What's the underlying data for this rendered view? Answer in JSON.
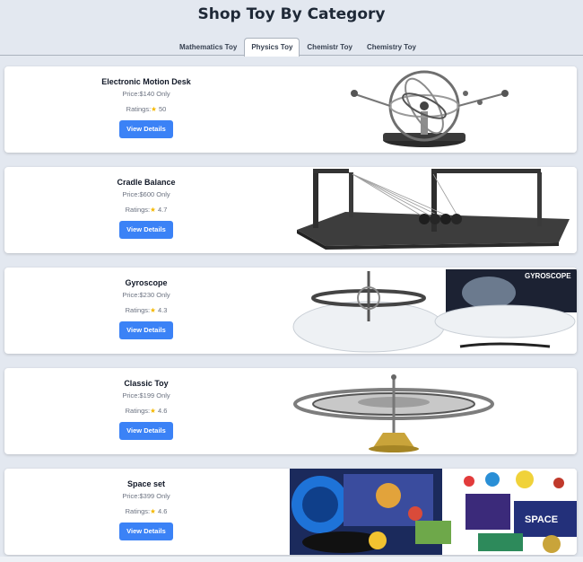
{
  "header": {
    "title": "Shop Toy By Category"
  },
  "tabs": [
    {
      "label": "Mathematics Toy",
      "active": false
    },
    {
      "label": "Physics Toy",
      "active": true
    },
    {
      "label": "Chemistr Toy",
      "active": false
    },
    {
      "label": "Chemistry Toy",
      "active": false
    }
  ],
  "products": [
    {
      "name": "Electronic Motion Desk",
      "price": "Price:$140 Only",
      "ratings_label": "Ratings:",
      "rating": "50",
      "button": "View Details",
      "image": "kinetic-motion-desk-toy"
    },
    {
      "name": "Cradle Balance",
      "price": "Price:$600 Only",
      "ratings_label": "Ratings:",
      "rating": "4.7",
      "button": "View Details",
      "image": "newtons-cradle"
    },
    {
      "name": "Gyroscope",
      "price": "Price:$230 Only",
      "ratings_label": "Ratings:",
      "rating": "4.3",
      "button": "View Details",
      "image": "gyroscope-with-box",
      "image_text": "GYROSCOPE"
    },
    {
      "name": "Classic Toy",
      "price": "Price:$199 Only",
      "ratings_label": "Ratings:",
      "rating": "4.6",
      "button": "View Details",
      "image": "spinning-gyro-top"
    },
    {
      "name": "Space set",
      "price": "Price:$399 Only",
      "ratings_label": "Ratings:",
      "rating": "4.6",
      "button": "View Details",
      "image": "space-science-kit",
      "image_text": "SPACE"
    }
  ],
  "colors": {
    "background": "#e3e8f0",
    "button": "#3b82f6",
    "star": "#f5b800",
    "card": "#ffffff"
  }
}
